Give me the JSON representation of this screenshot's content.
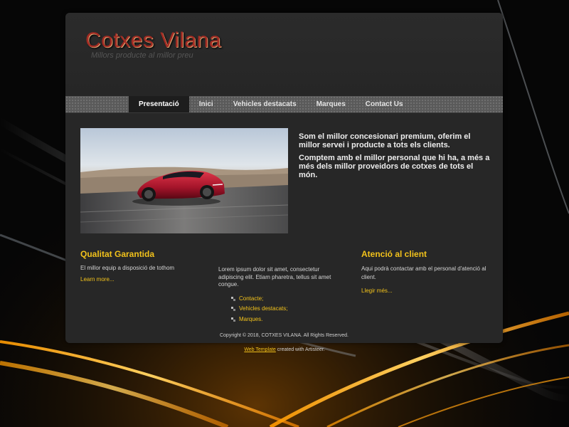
{
  "header": {
    "title": "Cotxes Vilana",
    "slogan": "Millors producte al millor preu"
  },
  "nav": {
    "items": [
      {
        "label": "Presentació",
        "active": true
      },
      {
        "label": "Inici"
      },
      {
        "label": "Vehicles destacats"
      },
      {
        "label": "Marques"
      },
      {
        "label": "Contact Us"
      }
    ]
  },
  "intro": {
    "p1": "Som el millor concesionari premium, oferim el millor servei i producte a tots els clients.",
    "p2": "Comptem amb el millor personal que hi ha, a més a més dels millor proveidors de cotxes de tots el món."
  },
  "columns": {
    "col1": {
      "heading": "Qualitat Garantida",
      "text": "El millor equip a disposició de tothom",
      "link": "Learn more..."
    },
    "col2": {
      "text": "Lorem ipsum dolor sit amet, consectetur adipiscing elit. Etiam pharetra, tellus sit amet congue.",
      "links": [
        "Contacte;",
        "Vehicles destacats;",
        "Marques."
      ]
    },
    "col3": {
      "heading": "Atenció al client",
      "text": "Aqui podrà contactar amb el personal d'atenció al client.",
      "link": "Llegir més..."
    }
  },
  "footer": {
    "copyright": "Copyright © 2018, COTXES VILANA. All Rights Reserved.",
    "credit_link": "Web Template",
    "credit_rest": " created with Artisteer."
  },
  "colors": {
    "accent": "#f2c21b",
    "logo": "#a32b23",
    "page_bg": "#272727",
    "car": "#b0182a"
  },
  "icons": {
    "hero": "red-sports-car-photo",
    "bullet": "square-bullet-icon"
  }
}
